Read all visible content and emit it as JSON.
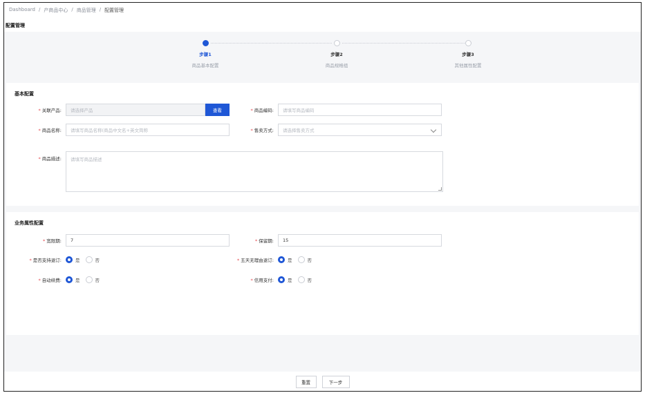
{
  "breadcrumb": [
    "Dashboard",
    "产商品中心",
    "商品管理",
    "配置管理"
  ],
  "breadcrumb_sep": "/",
  "page_title": "配置管理",
  "steps": [
    {
      "title": "步骤1",
      "desc": "商品基本配置",
      "state": "active"
    },
    {
      "title": "步骤2",
      "desc": "商品规格组",
      "state": "pending"
    },
    {
      "title": "步骤3",
      "desc": "其他属性配置",
      "state": "pending"
    }
  ],
  "basic_section": {
    "title": "基本配置",
    "related_product": {
      "label": "关联产品:",
      "placeholder": "请选择产品",
      "button": "查看"
    },
    "product_code": {
      "label": "商品编码:",
      "placeholder": "请填写商品编码"
    },
    "product_name": {
      "label": "商品名称:",
      "placeholder": "请填写商品名称(商品中文名+英文简称"
    },
    "sale_method": {
      "label": "售卖方式:",
      "placeholder": "请选择售卖方式"
    },
    "product_desc": {
      "label": "商品描述:",
      "placeholder": "请填写商品描述"
    }
  },
  "business_section": {
    "title": "业务属性配置",
    "grace_period": {
      "label": "宽限期:",
      "value": "7"
    },
    "retention_period": {
      "label": "保留期:",
      "value": "15"
    },
    "support_unsubscribe": {
      "label": "是否支持退订:",
      "options": [
        "是",
        "否"
      ],
      "selected": "是"
    },
    "five_day_refund": {
      "label": "五天无理由退订:",
      "options": [
        "是",
        "否"
      ],
      "selected": "是"
    },
    "auto_renew": {
      "label": "自动续费:",
      "options": [
        "是",
        "否"
      ],
      "selected": "是"
    },
    "credit_payment": {
      "label": "信用支付:",
      "options": [
        "是",
        "否"
      ],
      "selected": "是"
    }
  },
  "actions": {
    "reset": "重置",
    "next": "下一步"
  },
  "colors": {
    "primary": "#1f57d6",
    "required": "#e5484d",
    "background": "#f5f6f8"
  }
}
